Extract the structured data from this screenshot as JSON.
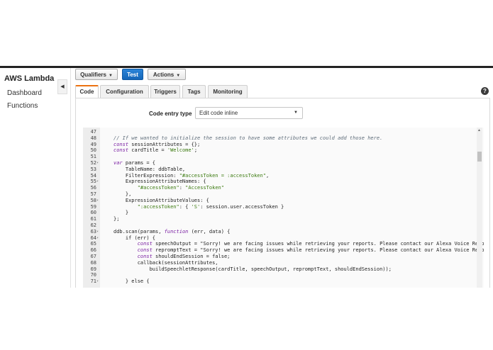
{
  "sidebar": {
    "title": "AWS Lambda",
    "items": [
      {
        "label": "Dashboard"
      },
      {
        "label": "Functions"
      }
    ]
  },
  "toolbar": {
    "qualifiers_label": "Qualifiers",
    "test_label": "Test",
    "actions_label": "Actions"
  },
  "tabs": [
    {
      "label": "Code",
      "active": true
    },
    {
      "label": "Configuration"
    },
    {
      "label": "Triggers"
    },
    {
      "label": "Tags"
    },
    {
      "label": "Monitoring"
    }
  ],
  "code_entry": {
    "label": "Code entry type",
    "value": "Edit code inline"
  },
  "editor": {
    "lines": [
      {
        "n": "47",
        "text": ""
      },
      {
        "n": "48",
        "text": "// If we wanted to initialize the session to have some attributes we could add those here."
      },
      {
        "n": "49",
        "text": "const sessionAttributes = {};"
      },
      {
        "n": "50",
        "text": "const cardTitle = 'Welcome';"
      },
      {
        "n": "51",
        "text": ""
      },
      {
        "n": "52",
        "fold": true,
        "text": "var params = {"
      },
      {
        "n": "53",
        "text": "    TableName: ddbTable,"
      },
      {
        "n": "54",
        "text": "    FilterExpression: \"#accessToken = :accessToken\","
      },
      {
        "n": "55",
        "fold": true,
        "text": "    ExpressionAttributeNames: {"
      },
      {
        "n": "56",
        "text": "        \"#accessToken\": \"AccessToken\""
      },
      {
        "n": "57",
        "text": "    },"
      },
      {
        "n": "58",
        "fold": true,
        "text": "    ExpressionAttributeValues: {"
      },
      {
        "n": "59",
        "text": "        \":accessToken\": { 'S': session.user.accessToken }"
      },
      {
        "n": "60",
        "text": "    }"
      },
      {
        "n": "61",
        "text": "};"
      },
      {
        "n": "62",
        "text": ""
      },
      {
        "n": "63",
        "fold": true,
        "text": "ddb.scan(params, function (err, data) {"
      },
      {
        "n": "64",
        "fold": true,
        "text": "    if (err) {"
      },
      {
        "n": "65",
        "text": "        const speechOutput = \"Sorry! we are facing issues while retrieving your reports. Please contact our Alexa Voice Reports"
      },
      {
        "n": "66",
        "text": "        const repromptText = \"Sorry! we are facing issues while retrieving your reports. Please contact our Alexa Voice Reports"
      },
      {
        "n": "67",
        "text": "        const shouldEndSession = false;"
      },
      {
        "n": "68",
        "text": "        callback(sessionAttributes,"
      },
      {
        "n": "69",
        "text": "            buildSpeechletResponse(cardTitle, speechOutput, repromptText, shouldEndSession));"
      },
      {
        "n": "70",
        "text": ""
      },
      {
        "n": "71",
        "fold": true,
        "text": "    } else {"
      }
    ]
  }
}
